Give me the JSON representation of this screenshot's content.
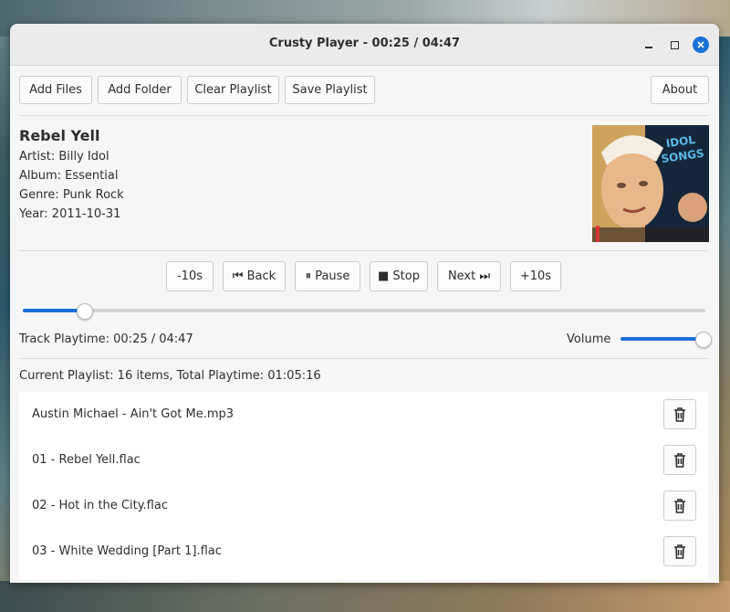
{
  "window": {
    "title": "Crusty Player - 00:25 / 04:47"
  },
  "toolbar": {
    "add_files": "Add Files",
    "add_folder": "Add Folder",
    "clear_playlist": "Clear Playlist",
    "save_playlist": "Save Playlist",
    "about": "About"
  },
  "track": {
    "title": "Rebel Yell",
    "artist": "Artist: Billy Idol",
    "album": "Album: Essential",
    "genre": "Genre: Punk Rock",
    "year": "Year: 2011-10-31",
    "cover_text": "IDOL SONGS"
  },
  "controls": {
    "minus10": "-10s",
    "back": "⏮ Back",
    "pause": "⏸ Pause",
    "stop": "■ Stop",
    "next": "Next ⏭",
    "plus10": "+10s"
  },
  "progress": {
    "fraction": 0.09
  },
  "status": {
    "playtime": "Track Playtime: 00:25 / 04:47",
    "volume_label": "Volume",
    "volume_fraction": 1.0
  },
  "playlist": {
    "summary": "Current Playlist: 16 items, Total Playtime: 01:05:16",
    "items": [
      {
        "label": "Austin Michael - Ain't Got Me.mp3"
      },
      {
        "label": "01 - Rebel Yell.flac"
      },
      {
        "label": "02 - Hot in the City.flac"
      },
      {
        "label": "03 - White Wedding [Part 1].flac"
      }
    ]
  },
  "colors": {
    "accent": "#1c71d8",
    "window_bg": "#f6f6f6"
  }
}
